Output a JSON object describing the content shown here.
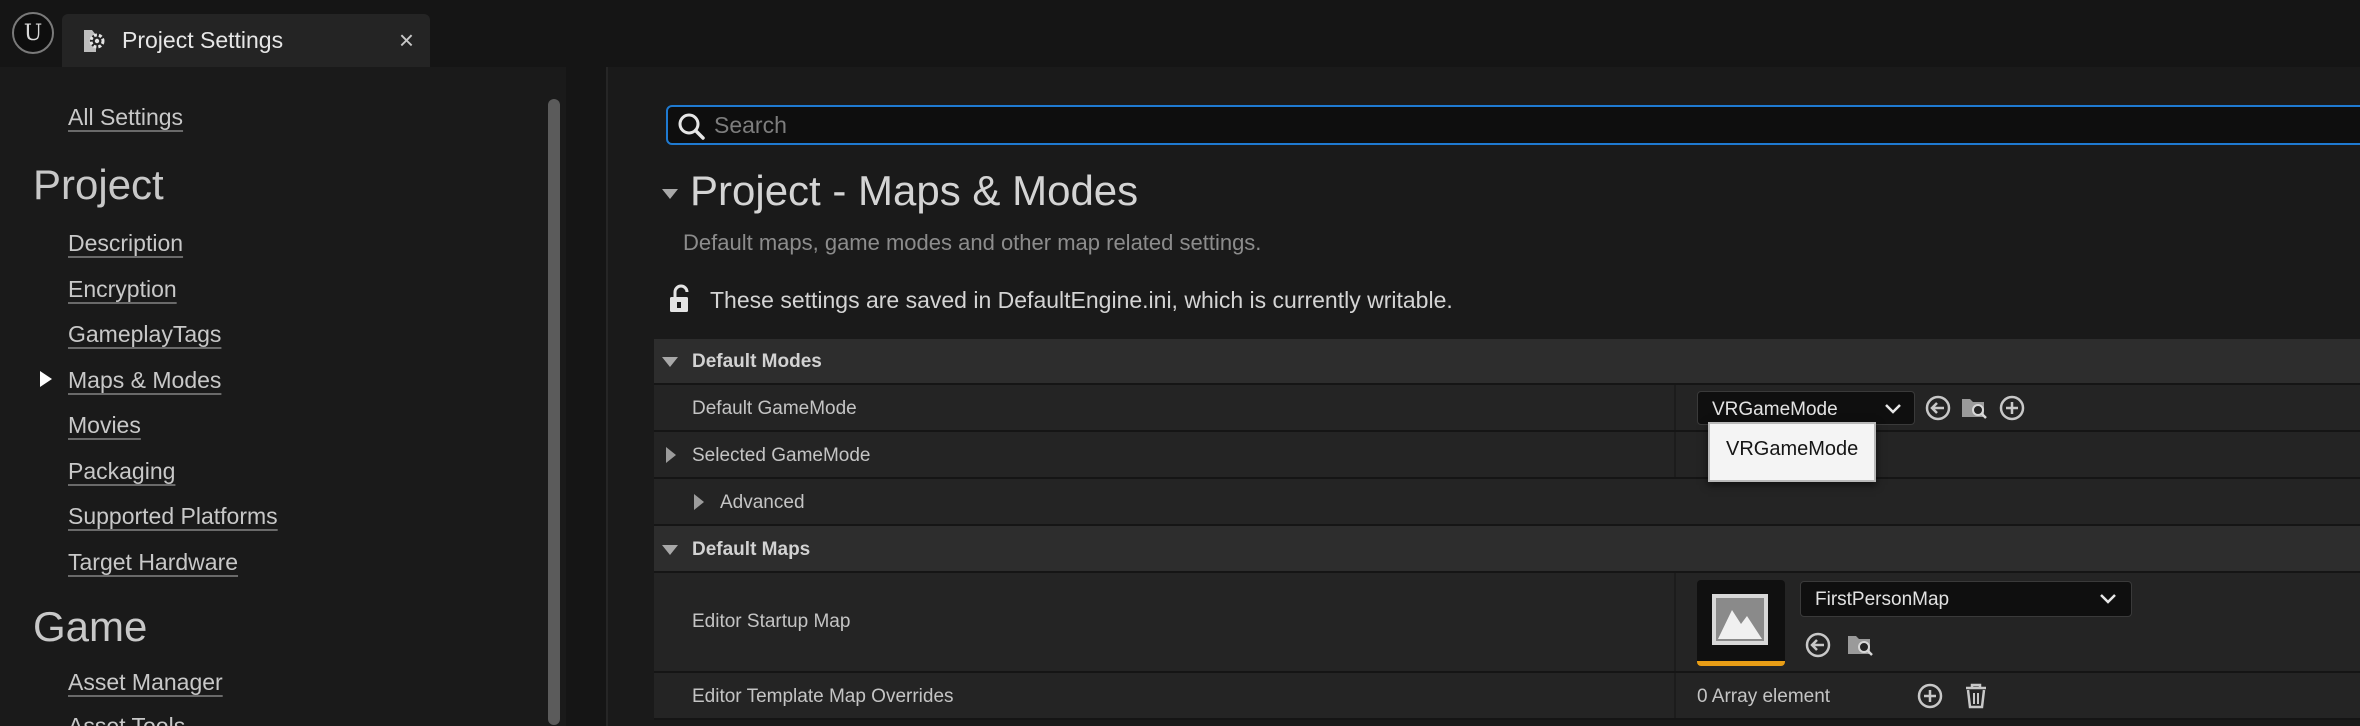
{
  "window": {
    "tab_title": "Project Settings",
    "close_glyph": "×"
  },
  "sidebar": {
    "top_link": "All Settings",
    "sections": [
      {
        "heading": "Project",
        "items": [
          {
            "label": "Description"
          },
          {
            "label": "Encryption"
          },
          {
            "label": "GameplayTags"
          },
          {
            "label": "Maps & Modes",
            "selected": true
          },
          {
            "label": "Movies"
          },
          {
            "label": "Packaging"
          },
          {
            "label": "Supported Platforms"
          },
          {
            "label": "Target Hardware"
          }
        ]
      },
      {
        "heading": "Game",
        "items": [
          {
            "label": "Asset Manager"
          },
          {
            "label": "Asset Tools"
          }
        ]
      }
    ]
  },
  "search": {
    "placeholder": "Search",
    "value": ""
  },
  "page": {
    "title": "Project - Maps & Modes",
    "subtitle": "Default maps, game modes and other map related settings.",
    "notice": "These settings are saved in DefaultEngine.ini, which is currently writable."
  },
  "properties": {
    "default_modes": {
      "label": "Default Modes",
      "default_gamemode": {
        "label": "Default GameMode",
        "value": "VRGameMode",
        "dropdown_options": [
          "VRGameMode"
        ]
      },
      "selected_gamemode": {
        "label": "Selected GameMode"
      },
      "advanced": {
        "label": "Advanced"
      }
    },
    "default_maps": {
      "label": "Default Maps",
      "editor_startup_map": {
        "label": "Editor Startup Map",
        "value": "FirstPersonMap"
      },
      "editor_template_map_overrides": {
        "label": "Editor Template Map Overrides",
        "value": "0 Array element"
      }
    }
  },
  "colors": {
    "accent_focus": "#1f7ad1",
    "asset_thumbnail_bar": "#e89d16",
    "panel_bg": "#1a1a1a",
    "row_bg": "#242424",
    "category_bg": "#2d2d2d"
  },
  "icons": {
    "engine_logo": "unreal-logo-icon",
    "tab": "settings-gear-icon",
    "search": "search-icon",
    "lock": "unlocked-padlock-icon",
    "use_selected": "use-selected-arrow-icon",
    "browse": "browse-folder-icon",
    "add": "plus-circle-icon",
    "delete": "trash-icon",
    "combo": "chevron-down-icon"
  }
}
